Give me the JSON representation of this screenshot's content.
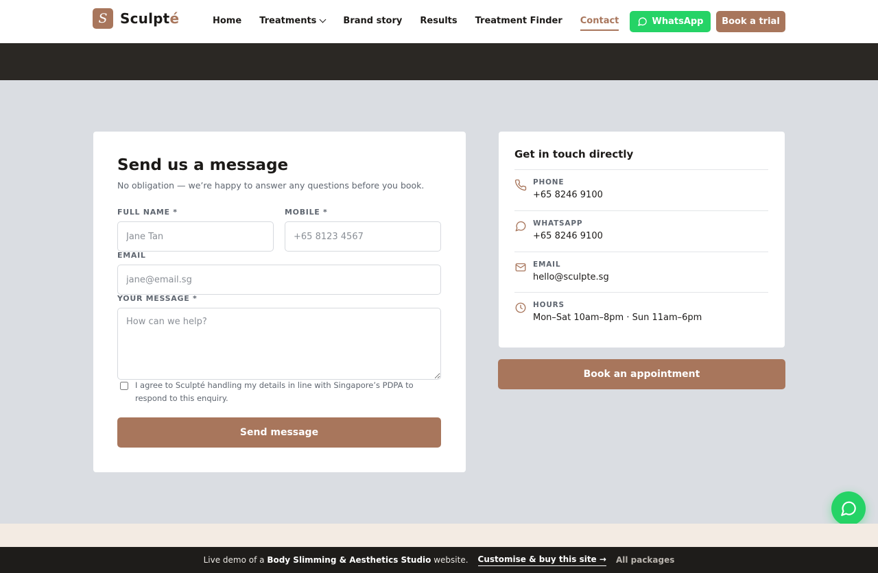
{
  "brand": {
    "logo_letter": "S",
    "name_main": "Sculpt",
    "name_accent": "é"
  },
  "nav": {
    "items": [
      {
        "label": "Home"
      },
      {
        "label": "Treatments"
      },
      {
        "label": "Brand story"
      },
      {
        "label": "Results"
      },
      {
        "label": "Treatment Finder"
      },
      {
        "label": "Contact"
      }
    ],
    "active": "Contact"
  },
  "header_actions": {
    "whatsapp_label": "WhatsApp",
    "trial_label": "Book a trial"
  },
  "form": {
    "title": "Send us a message",
    "subtitle": "No obligation — we’re happy to answer any questions before you book.",
    "full_name_label": "FULL NAME *",
    "full_name_placeholder": "Jane Tan",
    "mobile_label": "MOBILE *",
    "mobile_placeholder": "+65 8123 4567",
    "email_label": "EMAIL",
    "email_placeholder": "jane@email.sg",
    "message_label": "YOUR MESSAGE *",
    "message_placeholder": "How can we help?",
    "consent_text": "I agree to Sculpté handling my details in line with Singapore’s PDPA to respond to this enquiry.",
    "submit_label": "Send message"
  },
  "contact": {
    "title": "Get in touch directly",
    "rows": [
      {
        "label": "PHONE",
        "value": "+65 8246 9100",
        "icon": "phone-icon"
      },
      {
        "label": "WHATSAPP",
        "value": "+65 8246 9100",
        "icon": "chat-bubble-icon"
      },
      {
        "label": "EMAIL",
        "value": "hello@sculpte.sg",
        "icon": "mail-icon"
      },
      {
        "label": "HOURS",
        "value": "Mon–Sat 10am–8pm · Sun 11am–6pm",
        "icon": "clock-icon"
      }
    ],
    "appointment_label": "Book an appointment"
  },
  "demo_bar": {
    "prefix": "Live demo of a",
    "site_type": "Body Slimming & Aesthetics Studio",
    "suffix": "website.",
    "cta": "Customise & buy this site →",
    "all_packages": "All packages"
  },
  "colors": {
    "accent": "#a8765c",
    "whatsapp": "#25d366",
    "dark": "#2b2824",
    "page_bg": "#dadde2"
  }
}
